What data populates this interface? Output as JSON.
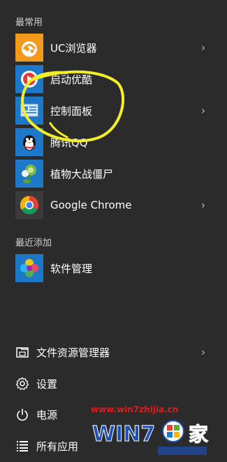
{
  "start_menu": {
    "most_used_header": "最常用",
    "recently_added_header": "最近添加",
    "most_used": [
      {
        "label": "UC浏览器",
        "icon": "uc-browser-icon",
        "has_submenu": true
      },
      {
        "label": "启动优酷",
        "icon": "youku-icon",
        "has_submenu": false
      },
      {
        "label": "控制面板",
        "icon": "control-panel-icon",
        "has_submenu": true
      },
      {
        "label": "腾讯QQ",
        "icon": "qq-penguin-icon",
        "has_submenu": false
      },
      {
        "label": "植物大战僵尸",
        "icon": "plants-vs-zombies-icon",
        "has_submenu": false
      },
      {
        "label": "Google Chrome",
        "icon": "chrome-icon",
        "has_submenu": true
      }
    ],
    "recently_added": [
      {
        "label": "软件管理",
        "icon": "software-manager-icon",
        "has_submenu": false
      }
    ],
    "bottom": [
      {
        "label": "文件资源管理器",
        "icon": "file-explorer-icon",
        "has_submenu": true
      },
      {
        "label": "设置",
        "icon": "settings-gear-icon",
        "has_submenu": false
      },
      {
        "label": "电源",
        "icon": "power-icon",
        "has_submenu": false
      },
      {
        "label": "所有应用",
        "icon": "all-apps-list-icon",
        "has_submenu": false
      }
    ],
    "chevron": "›"
  },
  "watermark": {
    "url": "www.win7zhijia.cn",
    "logo_text": "Win7之家"
  },
  "colors": {
    "background": "#2b2b2b",
    "tile_blue": "#1e78c8",
    "highlight_annotation": "#f2ee2a",
    "watermark_red": "#d81e1e"
  }
}
